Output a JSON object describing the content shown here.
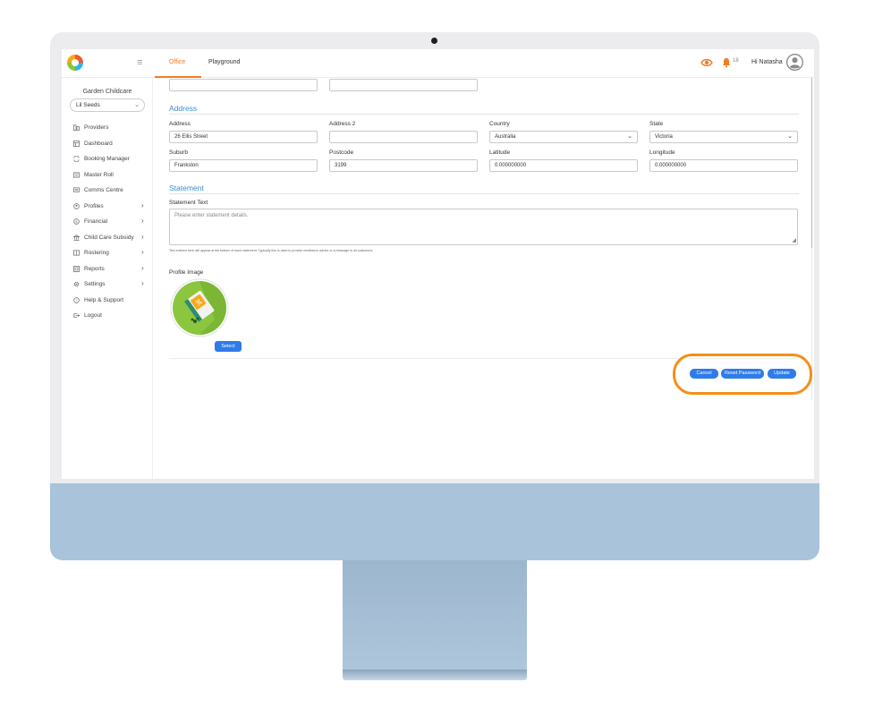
{
  "header": {
    "tabs": [
      {
        "label": "Office",
        "active": true
      },
      {
        "label": "Playground",
        "active": false
      }
    ],
    "notification_count": "18",
    "greeting": "Hi Natasha"
  },
  "sidebar": {
    "org_name": "Garden Childcare",
    "selected_service": "Lil Seeds",
    "items": [
      {
        "label": "Providers",
        "icon": "providers-icon",
        "has_submenu": false
      },
      {
        "label": "Dashboard",
        "icon": "dashboard-icon",
        "has_submenu": false
      },
      {
        "label": "Booking Manager",
        "icon": "booking-icon",
        "has_submenu": false
      },
      {
        "label": "Master Roll",
        "icon": "master-roll-icon",
        "has_submenu": false
      },
      {
        "label": "Comms Centre",
        "icon": "comms-icon",
        "has_submenu": false
      },
      {
        "label": "Profiles",
        "icon": "profiles-icon",
        "has_submenu": true
      },
      {
        "label": "Financial",
        "icon": "financial-icon",
        "has_submenu": true
      },
      {
        "label": "Child Care Subsidy",
        "icon": "subsidy-icon",
        "has_submenu": true
      },
      {
        "label": "Rostering",
        "icon": "rostering-icon",
        "has_submenu": true
      },
      {
        "label": "Reports",
        "icon": "reports-icon",
        "has_submenu": true
      },
      {
        "label": "Settings",
        "icon": "settings-icon",
        "has_submenu": true
      },
      {
        "label": "Help & Support",
        "icon": "help-icon",
        "has_submenu": false
      },
      {
        "label": "Logout",
        "icon": "logout-icon",
        "has_submenu": false
      }
    ]
  },
  "address": {
    "section_title": "Address",
    "address_label": "Address",
    "address_value": "26 Ellis Street",
    "address2_label": "Address 2",
    "address2_value": "",
    "country_label": "Country",
    "country_value": "Australia",
    "state_label": "State",
    "state_value": "Victoria",
    "suburb_label": "Suburb",
    "suburb_value": "Frankston",
    "postcode_label": "Postcode",
    "postcode_value": "3199",
    "latitude_label": "Latitude",
    "latitude_value": "0.000000000",
    "longitude_label": "Longitude",
    "longitude_value": "0.000000000"
  },
  "statement": {
    "section_title": "Statement",
    "text_label": "Statement Text",
    "text_placeholder": "Please enter statement details.",
    "hint": "Text entered here will appear at the bottom of each statement. Typically this is used to provide remittance advice or a message to all customers."
  },
  "profile_image": {
    "label": "Profile Image",
    "select_label": "Select"
  },
  "actions": {
    "cancel_label": "Cancel",
    "reset_password_label": "Reset Password",
    "update_label": "Update"
  },
  "colors": {
    "accent": "#f47a20",
    "link_blue": "#3a8ed5",
    "button_blue": "#2f7bea",
    "highlight_orange": "#f39018"
  }
}
